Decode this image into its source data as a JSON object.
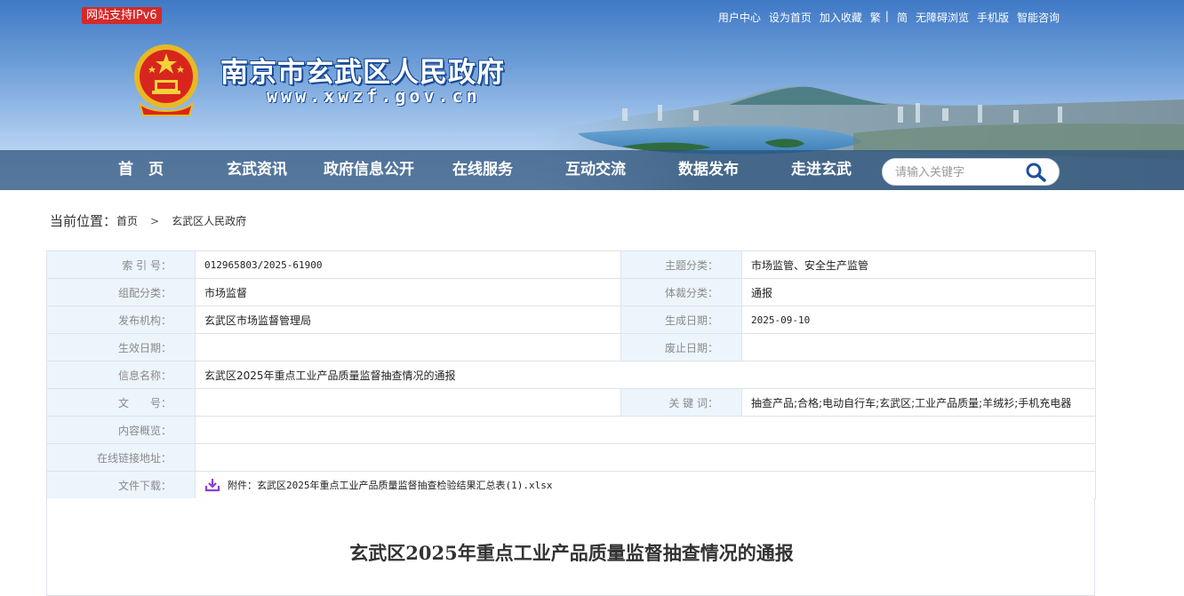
{
  "header": {
    "ipv6_badge": "网站支持IPv6",
    "site_name": "南京市玄武区人民政府",
    "site_url": "www.xwzf.gov.cn",
    "top_links": [
      "用户中心",
      "设为首页",
      "加入收藏",
      "繁",
      "|",
      "简",
      "无障碍浏览",
      "手机版",
      "智能咨询"
    ]
  },
  "nav": {
    "items": [
      "首　页",
      "玄武资讯",
      "政府信息公开",
      "在线服务",
      "互动交流",
      "数据发布",
      "走进玄武"
    ],
    "search_placeholder": "请输入关键字"
  },
  "breadcrumb": {
    "label": "当前位置：",
    "items": [
      "首页",
      "玄武区人民政府"
    ],
    "separator": ">"
  },
  "info": {
    "index_label": "索 引 号：",
    "index_value": "012965803/2025-61900",
    "topic_label": "主题分类：",
    "topic_value": "市场监管、安全生产监管",
    "org_cat_label": "组配分类：",
    "org_cat_value": "市场监督",
    "genre_label": "体裁分类：",
    "genre_value": "通报",
    "publisher_label": "发布机构：",
    "publisher_value": "玄武区市场监督管理局",
    "created_label": "生成日期：",
    "created_value": "2025-09-10",
    "effective_label": "生效日期：",
    "effective_value": "",
    "abolish_label": "废止日期：",
    "abolish_value": "",
    "name_label": "信息名称：",
    "name_value": "玄武区2025年重点工业产品质量监督抽查情况的通报",
    "doc_no_label": "文　　号：",
    "doc_no_value": "",
    "keywords_label": "关 键 词：",
    "keywords_value": "抽查产品;合格;电动自行车;玄武区;工业产品质量;羊绒衫;手机充电器",
    "summary_label": "内容概览：",
    "summary_value": "",
    "link_label": "在线链接地址：",
    "link_value": "",
    "download_label": "文件下载：",
    "download_value": "附件：玄武区2025年重点工业产品质量监督抽查检验结果汇总表(1).xlsx"
  },
  "article": {
    "title": "玄武区2025年重点工业产品质量监督抽查情况的通报"
  },
  "colors": {
    "nav_bar": "#2a4f78",
    "label_bg": "#ecf4fc",
    "badge_red": "#d62929",
    "download_icon": "#8a3fd6"
  },
  "icons": {
    "emblem": "national-emblem-icon",
    "search": "search-icon",
    "download": "download-icon"
  }
}
